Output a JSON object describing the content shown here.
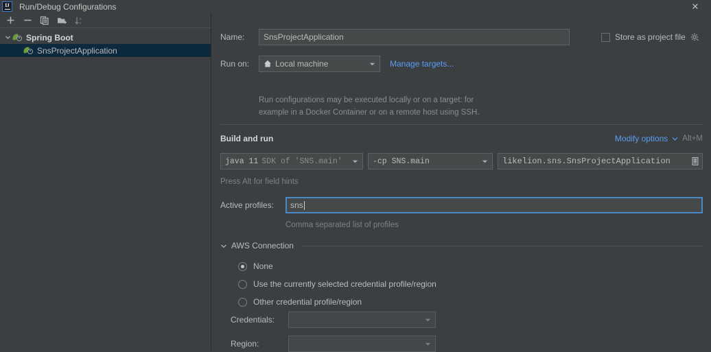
{
  "window": {
    "title": "Run/Debug Configurations",
    "logo_text": "IJ",
    "close_label": "✕"
  },
  "sidebar": {
    "toolbar": [
      {
        "name": "add-configuration-button",
        "icon": "plus-icon",
        "label": "+"
      },
      {
        "name": "remove-configuration-button",
        "icon": "minus-icon",
        "label": "−"
      },
      {
        "name": "copy-configuration-button",
        "icon": "copy-icon",
        "label": "Copy"
      },
      {
        "name": "new-folder-button",
        "icon": "folder-add-icon",
        "label": "New Folder"
      },
      {
        "name": "sort-configurations-button",
        "icon": "sort-az-icon",
        "label": "Sort"
      }
    ],
    "tree": [
      {
        "label": "Spring Boot",
        "icon": "spring-boot-icon",
        "expanded": true,
        "selected": false
      },
      {
        "label": "SnsProjectApplication",
        "icon": "spring-boot-icon",
        "expanded": false,
        "selected": true
      }
    ]
  },
  "form": {
    "name_label": "Name:",
    "name_value": "SnsProjectApplication",
    "store_as_project_file_label": "Store as project file",
    "store_as_project_file_checked": false,
    "store_gear_icon": "gear-icon",
    "run_on_label": "Run on:",
    "run_on_value": "Local machine",
    "run_on_icon": "home-icon",
    "manage_targets_link": "Manage targets...",
    "run_on_description_line1": "Run configurations may be executed locally or on a target: for",
    "run_on_description_line2": "example in a Docker Container or on a remote host using SSH."
  },
  "build_and_run": {
    "section_title": "Build and run",
    "modify_options_link": "Modify options",
    "modify_options_shortcut": "Alt+M",
    "jdk_prefix": "java 11",
    "jdk_suffix": "SDK of 'SNS.main'",
    "classpath_value": "-cp SNS.main",
    "main_class_value": "likelion.sns.SnsProjectApplication",
    "main_class_browse_icon": "browse-list-icon",
    "field_hints_note": "Press Alt for field hints",
    "active_profiles_label": "Active profiles:",
    "active_profiles_value": "sns",
    "active_profiles_note": "Comma separated list of profiles"
  },
  "aws_connection": {
    "section_title": "AWS Connection",
    "expanded": true,
    "options": [
      {
        "label": "None",
        "selected": true
      },
      {
        "label": "Use the currently selected credential profile/region",
        "selected": false
      },
      {
        "label": "Other credential profile/region",
        "selected": false
      }
    ],
    "credentials_label": "Credentials:",
    "credentials_value": "",
    "region_label": "Region:",
    "region_value": ""
  },
  "colors": {
    "background": "#3c3f41",
    "selection": "#0d293e",
    "link": "#589df6",
    "focus_border": "#4a88c7",
    "input_background": "#45494a"
  }
}
